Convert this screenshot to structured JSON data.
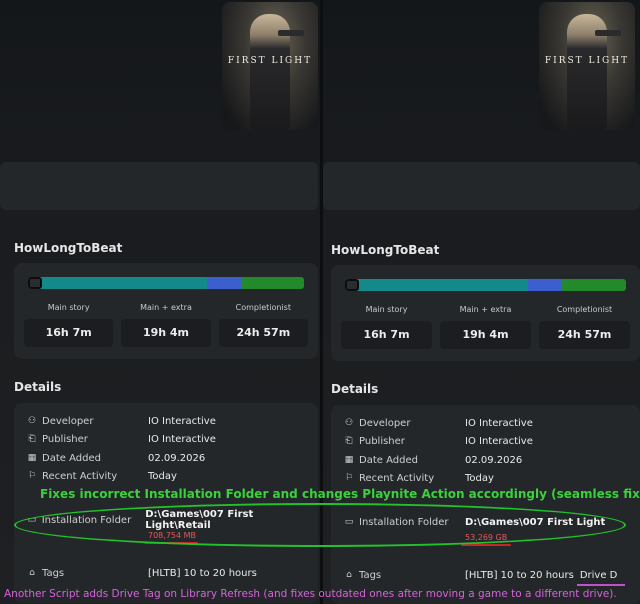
{
  "panels": {
    "left": {
      "cover_title": "FIRST LIGHT",
      "hltb": {
        "title": "HowLongToBeat",
        "bar_fractions": [
          0.65,
          0.12,
          0.23
        ],
        "main_story_label": "Main story",
        "main_story_time": "16h 7m",
        "main_extra_label": "Main + extra",
        "main_extra_time": "19h 4m",
        "completionist_label": "Completionist",
        "completionist_time": "24h 57m"
      },
      "details": {
        "title": "Details",
        "developer_label": "Developer",
        "developer_value": "IO Interactive",
        "publisher_label": "Publisher",
        "publisher_value": "IO Interactive",
        "date_added_label": "Date Added",
        "date_added_value": "02.09.2026",
        "recent_activity_label": "Recent Activity",
        "recent_activity_value": "Today",
        "install_folder_label": "Installation Folder",
        "install_folder_value": "D:\\Games\\007 First Light\\Retail",
        "install_size": "708,754 MB",
        "tags_label": "Tags",
        "tags_value": "[HLTB] 10 to 20 hours"
      }
    },
    "right": {
      "cover_title": "FIRST LIGHT",
      "hltb": {
        "title": "HowLongToBeat",
        "bar_fractions": [
          0.65,
          0.12,
          0.23
        ],
        "main_story_label": "Main story",
        "main_story_time": "16h 7m",
        "main_extra_label": "Main + extra",
        "main_extra_time": "19h 4m",
        "completionist_label": "Completionist",
        "completionist_time": "24h 57m"
      },
      "details": {
        "title": "Details",
        "developer_label": "Developer",
        "developer_value": "IO Interactive",
        "publisher_label": "Publisher",
        "publisher_value": "IO Interactive",
        "date_added_label": "Date Added",
        "date_added_value": "02.09.2026",
        "recent_activity_label": "Recent Activity",
        "recent_activity_value": "Today",
        "install_folder_label": "Installation Folder",
        "install_folder_value": "D:\\Games\\007 First Light",
        "install_size": "53,269 GB",
        "tags_label": "Tags",
        "tags_value": "[HLTB] 10 to 20 hours",
        "drive_tag": "Drive D"
      }
    }
  },
  "annotations": {
    "top_caption": "Fixes incorrect Installation Folder and changes Playnite Action accordingly (seamless fix)",
    "bottom_caption": "Another Script adds Drive Tag on Library Refresh (and fixes outdated ones after moving a game to a different drive).",
    "green_color": "#3ad13a",
    "magenta_color": "#d563d9",
    "red_color": "#c8242a"
  },
  "icons": {
    "developer": "people-icon",
    "publisher": "document-icon",
    "date_added": "calendar-icon",
    "recent_activity": "pin-icon",
    "install_folder": "folder-icon",
    "tags": "tag-icon"
  }
}
